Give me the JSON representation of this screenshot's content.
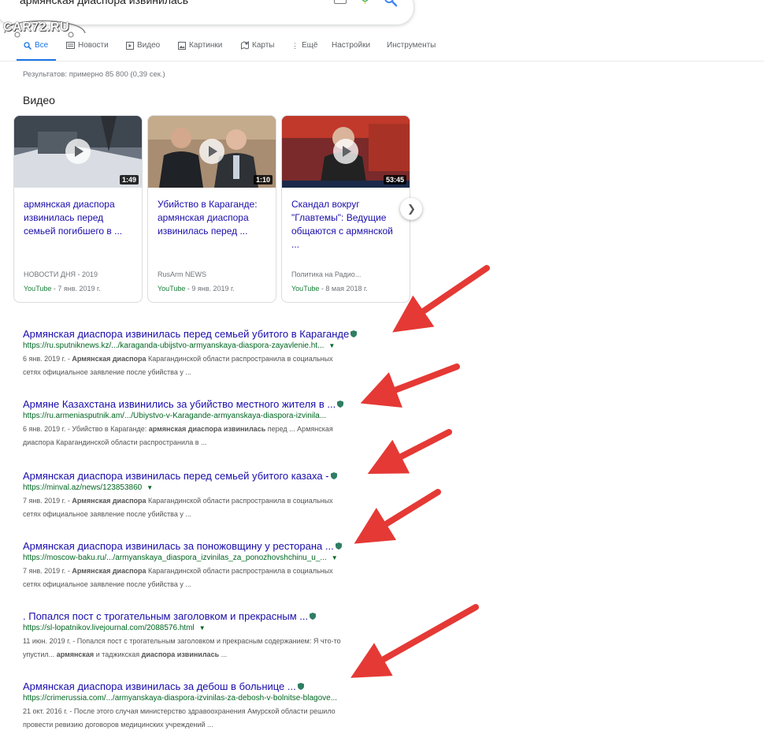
{
  "search": {
    "query": "армянская диаспора извинилась"
  },
  "watermark": "CAR72.RU",
  "tabs": [
    {
      "label": "Все",
      "icon": "search-icon"
    },
    {
      "label": "Новости",
      "icon": "news-icon"
    },
    {
      "label": "Видео",
      "icon": "video-icon"
    },
    {
      "label": "Картинки",
      "icon": "images-icon"
    },
    {
      "label": "Карты",
      "icon": "maps-icon"
    },
    {
      "label": "Ещё",
      "icon": "more-vert-icon"
    },
    {
      "label": "Настройки"
    },
    {
      "label": "Инструменты"
    }
  ],
  "stats": "Результатов: примерно 85 800 (0,39 сек.)",
  "videos": {
    "heading": "Видео",
    "items": [
      {
        "title": "армянская диаспора извинилась перед семьей погибшего в ...",
        "duration": "1:49",
        "source": "НОВОСТИ ДНЯ - 2019",
        "platform": "YouTube",
        "date": " - 7 янв. 2019 г."
      },
      {
        "title": "Убийство в Караганде: армянская диаспора извинилась перед ...",
        "duration": "1:10",
        "source": "RusArm NEWS",
        "platform": "YouTube",
        "date": " - 9 янв. 2019 г."
      },
      {
        "title": "Скандал вокруг \"Главтемы\": Ведущие общаются с армянской ...",
        "duration": "53:45",
        "source": "Политика на Радио...",
        "platform": "YouTube",
        "date": " - 8 мая 2018 г."
      }
    ]
  },
  "results": [
    {
      "title": "Армянская диаспора извинилась перед семьей убитого в Караганде",
      "url": "https://ru.sputniknews.kz/.../karaganda-ubijstvo-armyanskaya-diaspora-zayavlenie.ht...",
      "snippet1_pre": "6 янв. 2019 г. - ",
      "snippet1_bold": "Армянская диаспора",
      "snippet1_post": " Карагандинской области распространила в социальных",
      "snippet2_pre": "сетях официальное заявление после убийства у ...",
      "snippet2_bold": "",
      "snippet2_post": ""
    },
    {
      "title": "Армяне Казахстана извинились за убийство местного жителя в ...",
      "url": "https://ru.armeniasputnik.am/.../Ubiystvo-v-Karagande-armyanskaya-diaspora-izvinila...",
      "snippet1_pre": "6 янв. 2019 г. - Убийство в Караганде: ",
      "snippet1_bold": "армянская диаспора извинилась",
      "snippet1_post": " перед ... Армянская",
      "snippet2_pre": "диаспора Карагандинской области распространила в ...",
      "snippet2_bold": "",
      "snippet2_post": ""
    },
    {
      "title": "Армянская диаспора извинилась перед семьей убитого казаха -",
      "url": "https://minval.az/news/123853860",
      "snippet1_pre": "7 янв. 2019 г. - ",
      "snippet1_bold": "Армянская диаспора",
      "snippet1_post": " Карагандинской области распространила в социальных",
      "snippet2_pre": "сетях официальное заявление после убийства у ...",
      "snippet2_bold": "",
      "snippet2_post": ""
    },
    {
      "title": "Армянская диаспора извинилась за поножовщину у ресторана ...",
      "url": "https://moscow-baku.ru/.../armyanskaya_diaspora_izvinilas_za_ponozhovshchinu_u_...",
      "snippet1_pre": "7 янв. 2019 г. - ",
      "snippet1_bold": "Армянская диаспора",
      "snippet1_post": " Карагандинской области распространила в социальных",
      "snippet2_pre": "сетях официальное заявление после убийства у ...",
      "snippet2_bold": "",
      "snippet2_post": ""
    },
    {
      "title": ". Попался пост с трогательным заголовком и прекрасным ...",
      "url": "https://sl-lopatnikov.livejournal.com/2088576.html",
      "snippet1_pre": "11 июн. 2019 г. - Попался пост с трогательным заголовком и прекрасным содержанием: Я что-то",
      "snippet1_bold": "",
      "snippet1_post": "",
      "snippet2_pre": "упустил... ",
      "snippet2_bold": "армянская",
      "snippet2_mid": " и таджикская ",
      "snippet2_bold2": "диаспора извинилась",
      "snippet2_post": " ..."
    },
    {
      "title": "Армянская диаспора извинилась за дебош в больнице ...",
      "url": "https://crimerussia.com/.../armyanskaya-diaspora-izvinilas-za-debosh-v-bolnitse-blagove...",
      "snippet1_pre": "21 окт. 2016 г. - После этого случая министерство здравоохранения Амурской области решило",
      "snippet1_bold": "",
      "snippet1_post": "",
      "snippet2_pre": "провести ревизию договоров медицинских учреждений ...",
      "snippet2_bold": "",
      "snippet2_post": ""
    }
  ],
  "colors": {
    "link": "#1a0dab",
    "url": "#006621",
    "accent": "#1a73e8",
    "arrow": "#e53935"
  }
}
